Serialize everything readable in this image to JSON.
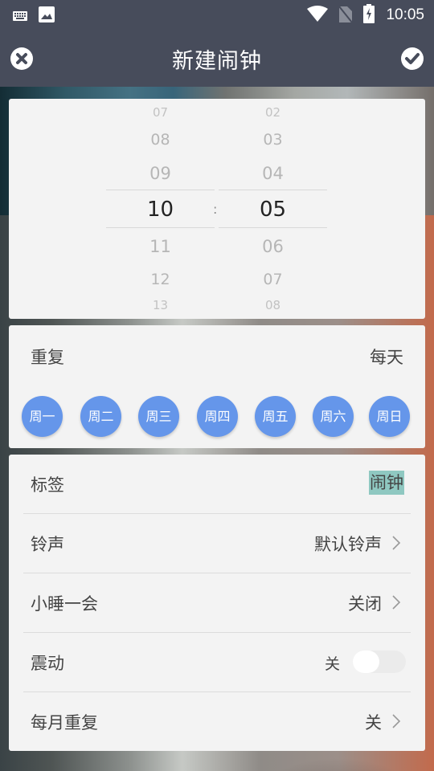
{
  "status_bar": {
    "time": "10:05",
    "left_icons": [
      "keyboard-icon",
      "image-icon"
    ],
    "right_icons": [
      "wifi-icon",
      "no-sim-icon",
      "battery-charging-icon"
    ]
  },
  "app_bar": {
    "title": "新建闹钟",
    "cancel_icon": "close-circle-icon",
    "confirm_icon": "check-circle-icon"
  },
  "time_picker": {
    "hours": [
      "07",
      "08",
      "09",
      "10",
      "11",
      "12",
      "13"
    ],
    "minutes": [
      "02",
      "03",
      "04",
      "05",
      "06",
      "07",
      "08"
    ],
    "selected_hour": "10",
    "selected_minute": "05",
    "separator": ":"
  },
  "repeat": {
    "label": "重复",
    "value": "每天",
    "days": [
      {
        "label": "周一",
        "selected": true
      },
      {
        "label": "周二",
        "selected": true
      },
      {
        "label": "周三",
        "selected": true
      },
      {
        "label": "周四",
        "selected": true
      },
      {
        "label": "周五",
        "selected": true
      },
      {
        "label": "周六",
        "selected": true
      },
      {
        "label": "周日",
        "selected": true
      }
    ],
    "accent_color": "#6596ea"
  },
  "settings": {
    "tag": {
      "label": "标签",
      "value": "闹钟"
    },
    "ringtone": {
      "label": "铃声",
      "value": "默认铃声"
    },
    "snooze": {
      "label": "小睡一会",
      "value": "关闭"
    },
    "vibrate": {
      "label": "震动",
      "state_label": "关",
      "on": false
    },
    "monthly_repeat": {
      "label": "每月重复",
      "value": "关"
    }
  }
}
